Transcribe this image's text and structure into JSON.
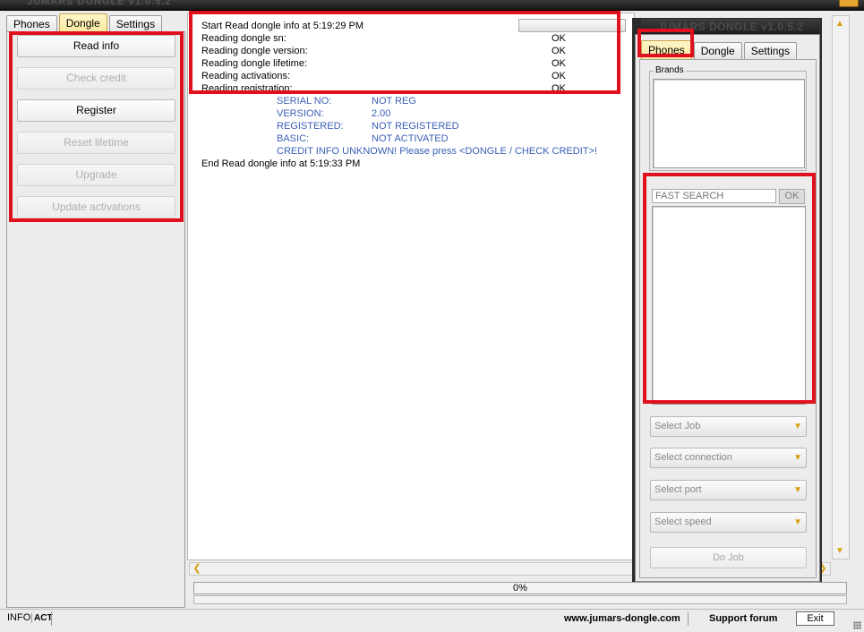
{
  "window": {
    "ghost_title": "JUMARS DONGLE v1.0.5.2"
  },
  "left": {
    "tabs": [
      {
        "label": "Phones"
      },
      {
        "label": "Dongle"
      },
      {
        "label": "Settings"
      }
    ],
    "buttons": [
      {
        "label": "Read info",
        "enabled": true
      },
      {
        "label": "Check credit",
        "enabled": false
      },
      {
        "label": "Register",
        "enabled": true
      },
      {
        "label": "Reset lifetime",
        "enabled": false
      },
      {
        "label": "Upgrade",
        "enabled": false
      },
      {
        "label": "Update activations",
        "enabled": false
      }
    ]
  },
  "log": {
    "lines": [
      {
        "text": "Start Read dongle info at 5:19:29 PM",
        "status": ""
      },
      {
        "text": "Reading dongle sn:",
        "status": "OK"
      },
      {
        "text": "Reading dongle version:",
        "status": "OK"
      },
      {
        "text": "Reading dongle lifetime:",
        "status": "OK"
      },
      {
        "text": "Reading activations:",
        "status": "OK"
      },
      {
        "text": "Reading registration:",
        "status": "OK"
      }
    ],
    "info": [
      {
        "label": "SERIAL NO:",
        "value": "NOT REG"
      },
      {
        "label": "VERSION:",
        "value": "2.00"
      },
      {
        "label": "REGISTERED:",
        "value": "NOT REGISTERED"
      },
      {
        "label": "BASIC:",
        "value": "NOT ACTIVATED"
      }
    ],
    "credit_note": "CREDIT INFO UNKNOWN! Please press <DONGLE / CHECK CREDIT>!",
    "end_line": "End Read dongle info at 5:19:33 PM"
  },
  "progress": {
    "label": "0%",
    "value": 0
  },
  "overlay": {
    "title": "JUMARS DONGLE v1.0.5.2",
    "tabs": [
      {
        "label": "Phones"
      },
      {
        "label": "Dongle"
      },
      {
        "label": "Settings"
      }
    ],
    "brands_label": "Brands",
    "search_placeholder": "FAST SEARCH",
    "search_ok": "OK",
    "selects": [
      {
        "label": "Select Job"
      },
      {
        "label": "Select connection"
      },
      {
        "label": "Select port"
      },
      {
        "label": "Select speed"
      }
    ],
    "do_job": "Do Job"
  },
  "status": {
    "info": "INFO",
    "act": "ACT",
    "url": "www.jumars-dongle.com",
    "forum": "Support forum",
    "exit": "Exit"
  },
  "colors": {
    "highlight_red": "#e0101e",
    "active_tab": "#fce9a0",
    "info_blue": "#3a5fb5",
    "accent_arrow": "#d6a012"
  }
}
